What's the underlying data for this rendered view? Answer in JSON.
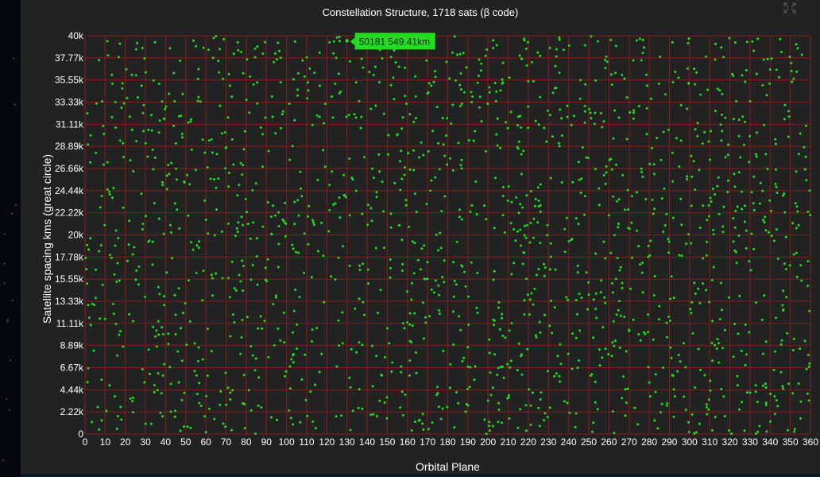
{
  "window": {
    "title": "Constellation Structure, 1718 sats (β code)",
    "expand_icon": "expand-icon"
  },
  "colors": {
    "background": "#222222",
    "grid": "#8b1a1a",
    "point": "#22dd22",
    "tooltip": "#22dd22",
    "text": "#ffffff"
  },
  "tooltip": {
    "text": "50181 549.41km"
  },
  "chart_data": {
    "type": "scatter",
    "title": "Constellation Structure, 1718 sats (β code)",
    "xlabel": "Orbital Plane",
    "ylabel": "Satellite spacing kms (great circle)",
    "xlim": [
      0,
      360
    ],
    "ylim": [
      0,
      40000
    ],
    "x_ticks": [
      "0",
      "10",
      "20",
      "30",
      "40",
      "50",
      "60",
      "70",
      "80",
      "90",
      "100",
      "110",
      "120",
      "130",
      "140",
      "150",
      "160",
      "170",
      "180",
      "190",
      "200",
      "210",
      "220",
      "230",
      "240",
      "250",
      "260",
      "270",
      "280",
      "290",
      "300",
      "310",
      "320",
      "330",
      "340",
      "350",
      "360"
    ],
    "y_ticks": [
      "0",
      "2.22k",
      "4.44k",
      "6.67k",
      "8.89k",
      "11.11k",
      "13.33k",
      "15.55k",
      "17.78k",
      "20k",
      "22.22k",
      "24.44k",
      "26.66k",
      "28.89k",
      "31.11k",
      "33.33k",
      "35.55k",
      "37.77k",
      "40k"
    ],
    "grid": true,
    "series": [
      {
        "point_count": 1718,
        "distribution": "uniform over 0–360 planes and 0–40k km",
        "highlighted": {
          "x": 130,
          "y": 39500
        }
      }
    ]
  }
}
